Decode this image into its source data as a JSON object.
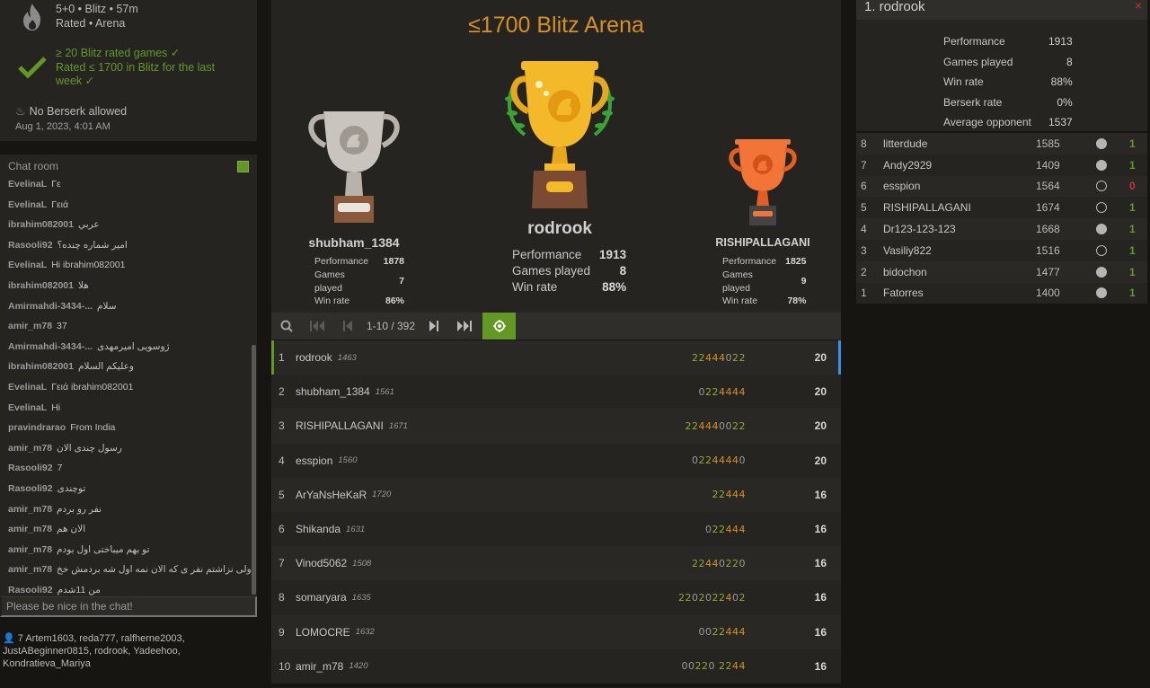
{
  "tournament": {
    "title": "≤1700 Blitz Arena",
    "clock_line": "5+0 • Blitz • 57m",
    "type_line": "Rated • Arena",
    "conditions": [
      "≥ 20 Blitz rated games ✓",
      "Rated ≤ 1700 in Blitz for the last week ✓"
    ],
    "berserk": "No Berserk allowed",
    "started": "Aug 1, 2023, 4:01 AM"
  },
  "chat": {
    "header": "Chat room",
    "placeholder": "Please be nice in the chat!",
    "lines": [
      {
        "user": "EvelinaL",
        "msg": "Γε"
      },
      {
        "user": "EvelinaL",
        "msg": "Γειά"
      },
      {
        "user": "ibrahim082001",
        "msg": "عربي"
      },
      {
        "user": "Rasooli92",
        "msg": "امیر شماره چنده؟"
      },
      {
        "user": "EvelinaL",
        "msg": "Hi ibrahim082001"
      },
      {
        "user": "ibrahim082001",
        "msg": "هلا"
      },
      {
        "user": "Amirmahdi-3434-...",
        "msg": "سلام"
      },
      {
        "user": "amir_m78",
        "msg": "37"
      },
      {
        "user": "Amirmahdi-3434-...",
        "msg": "ژوسویی امیرمهدی"
      },
      {
        "user": "ibrahim082001",
        "msg": "وعليكم السلام"
      },
      {
        "user": "EvelinaL",
        "msg": "Γειά ibrahim082001"
      },
      {
        "user": "EvelinaL",
        "msg": "Hi"
      },
      {
        "user": "pravindrarao",
        "msg": "From India"
      },
      {
        "user": "amir_m78",
        "msg": "رسول چندی الان"
      },
      {
        "user": "Rasooli92",
        "msg": "7"
      },
      {
        "user": "Rasooli92",
        "msg": "توچندی"
      },
      {
        "user": "amir_m78",
        "msg": "نفر رو بردم"
      },
      {
        "user": "amir_m78",
        "msg": "الان هم"
      },
      {
        "user": "amir_m78",
        "msg": "تو بهم میباختی اول بودم"
      },
      {
        "user": "amir_m78",
        "msg": "ولی نزاشتم نفر ی که الان نمه اول شه بردمش خخ"
      },
      {
        "user": "Rasooli92",
        "msg": "من 11شدم"
      }
    ]
  },
  "spectators": {
    "count": "7",
    "names": "Artem1603, reda777, ralfherne2003, JustABeginner0815, rodrook, Yadeehoo, Kondratieva_Mariya"
  },
  "podium": {
    "first": {
      "name": "rodrook",
      "perf_label": "Performance",
      "perf": "1913",
      "games_label": "Games played",
      "games": "8",
      "win_label": "Win rate",
      "win": "88%"
    },
    "second": {
      "name": "shubham_1384",
      "perf_label": "Performance",
      "perf": "1878",
      "games_label": "Games played",
      "games": "7",
      "win_label": "Win rate",
      "win": "86%"
    },
    "third": {
      "name": "RISHIPALLAGANI",
      "perf_label": "Performance",
      "perf": "1825",
      "games_label": "Games played",
      "games": "9",
      "win_label": "Win rate",
      "win": "78%"
    }
  },
  "pager": {
    "label": "1-10 / 392"
  },
  "standings": [
    {
      "rank": "1",
      "name": "rodrook",
      "rating": "1463",
      "sheet": "22444022",
      "total": "20",
      "me": true
    },
    {
      "rank": "2",
      "name": "shubham_1384",
      "rating": "1561",
      "sheet": "0224444",
      "total": "20"
    },
    {
      "rank": "3",
      "name": "RISHIPALLAGANI",
      "rating": "1671",
      "sheet": "224440022",
      "total": "20"
    },
    {
      "rank": "4",
      "name": "esspion",
      "rating": "1560",
      "sheet": "02244440",
      "total": "20"
    },
    {
      "rank": "5",
      "name": "ArYaNsHeKaR",
      "rating": "1720",
      "sheet": "22444",
      "total": "16"
    },
    {
      "rank": "6",
      "name": "Shikanda",
      "rating": "1631",
      "sheet": "022444",
      "total": "16"
    },
    {
      "rank": "7",
      "name": "Vinod5062",
      "rating": "1508",
      "sheet": "22440220",
      "total": "16"
    },
    {
      "rank": "8",
      "name": "somaryara",
      "rating": "1635",
      "sheet": "2202022402",
      "total": "16"
    },
    {
      "rank": "9",
      "name": "LOMOCRE",
      "rating": "1632",
      "sheet": "0022444",
      "total": "16"
    },
    {
      "rank": "10",
      "name": "amir_m78",
      "rating": "1420",
      "sheet": "00220 2244",
      "total": "16"
    }
  ],
  "player_panel": {
    "title": "1. rodrook",
    "close": "×",
    "stats": [
      {
        "label": "Performance",
        "value": "1913"
      },
      {
        "label": "Games played",
        "value": "8"
      },
      {
        "label": "Win rate",
        "value": "88%"
      },
      {
        "label": "Berserk rate",
        "value": "0%"
      },
      {
        "label": "Average opponent",
        "value": "1537"
      }
    ],
    "games": [
      {
        "r": "8",
        "name": "litterdude",
        "rating": "1585",
        "color": "white",
        "result": "1"
      },
      {
        "r": "7",
        "name": "Andy2929",
        "rating": "1409",
        "color": "white",
        "result": "1"
      },
      {
        "r": "6",
        "name": "esspion",
        "rating": "1564",
        "color": "black",
        "result": "0"
      },
      {
        "r": "5",
        "name": "RISHIPALLAGANI",
        "rating": "1674",
        "color": "black",
        "result": "1"
      },
      {
        "r": "4",
        "name": "Dr123-123-123",
        "rating": "1668",
        "color": "white",
        "result": "1"
      },
      {
        "r": "3",
        "name": "Vasiliy822",
        "rating": "1516",
        "color": "black",
        "result": "1"
      },
      {
        "r": "2",
        "name": "bidochon",
        "rating": "1477",
        "color": "white",
        "result": "1"
      },
      {
        "r": "1",
        "name": "Fatorres",
        "rating": "1400",
        "color": "white",
        "result": "1"
      }
    ]
  },
  "colors": {
    "accent_green": "#629924",
    "title_orange": "#d59120",
    "sheet_4": "#d59120",
    "sheet_2": "#8fa839",
    "sheet_0": "#9a9a9a",
    "loss_red": "#cc3333"
  }
}
